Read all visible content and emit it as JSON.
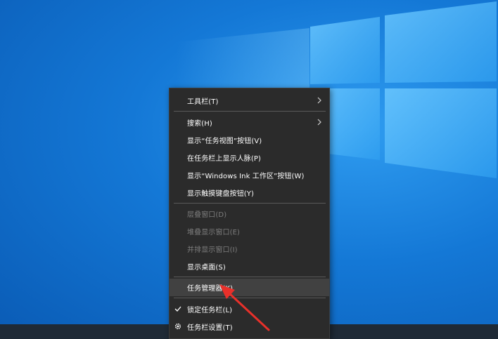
{
  "menu": {
    "items": [
      {
        "label": "工具栏(T)"
      },
      {
        "label": "搜索(H)"
      },
      {
        "label": "显示“任务视图”按钮(V)"
      },
      {
        "label": "在任务栏上显示人脉(P)"
      },
      {
        "label": "显示“Windows Ink 工作区”按钮(W)"
      },
      {
        "label": "显示触摸键盘按钮(Y)"
      },
      {
        "label": "层叠窗口(D)"
      },
      {
        "label": "堆叠显示窗口(E)"
      },
      {
        "label": "并排显示窗口(I)"
      },
      {
        "label": "显示桌面(S)"
      },
      {
        "label": "任务管理器(K)"
      },
      {
        "label": "锁定任务栏(L)"
      },
      {
        "label": "任务栏设置(T)"
      }
    ]
  },
  "icons": {
    "submenu": "chevron-right-icon",
    "lock_check": "checkmark-icon",
    "settings": "gear-icon",
    "annotation": "red-arrow-icon"
  },
  "colors": {
    "menu_bg": "#2b2b2b",
    "highlight": "#414141",
    "disabled_text": "#7d7d7d",
    "arrow": "#e8302a"
  }
}
